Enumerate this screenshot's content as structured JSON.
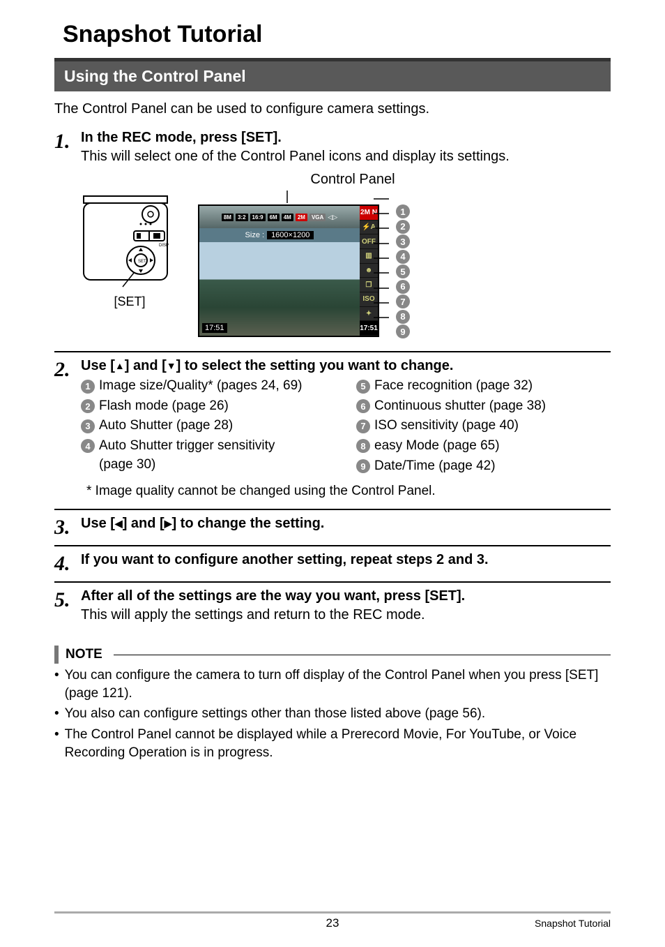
{
  "title": "Snapshot Tutorial",
  "section": "Using the Control Panel",
  "intro": "The Control Panel can be used to configure camera settings.",
  "steps": {
    "s1": {
      "num": "1.",
      "head": "In the REC mode, press [SET].",
      "sub": "This will select one of the Control Panel icons and display its settings.",
      "cp_label": "Control Panel",
      "set_label": "[SET]",
      "chips": [
        "8M",
        "3:2",
        "16:9",
        "6M",
        "4M",
        "2M",
        "VGA"
      ],
      "size_label": "Size :",
      "size_value": "1600×1200",
      "time": "17:51",
      "side_icons": [
        "2M N",
        "⚡A",
        "OFF",
        "▥",
        "☻",
        "❐",
        "ISO",
        "✦",
        "17:51"
      ]
    },
    "s2": {
      "num": "2.",
      "head_a": "Use [",
      "head_b": "] and [",
      "head_c": "] to select the setting you want to change.",
      "items_left": [
        "Image size/Quality* (pages 24, 69)",
        "Flash mode (page 26)",
        "Auto Shutter (page 28)",
        "Auto Shutter trigger sensitivity"
      ],
      "items_left_cont": "(page 30)",
      "items_right": [
        "Face recognition (page 32)",
        "Continuous shutter (page 38)",
        "ISO sensitivity (page 40)",
        "easy Mode (page 65)",
        "Date/Time (page 42)"
      ],
      "footnote": "* Image quality cannot be changed using the Control Panel."
    },
    "s3": {
      "num": "3.",
      "head_a": "Use [",
      "head_b": "] and [",
      "head_c": "] to change the setting."
    },
    "s4": {
      "num": "4.",
      "head": "If you want to configure another setting, repeat steps 2 and 3."
    },
    "s5": {
      "num": "5.",
      "head": "After all of the settings are the way you want, press [SET].",
      "sub": "This will apply the settings and return to the REC mode."
    }
  },
  "note": {
    "label": "NOTE",
    "items": [
      "You can configure the camera to turn off display of the Control Panel when you press [SET] (page 121).",
      "You also can configure settings other than those listed above (page 56).",
      "The Control Panel cannot be displayed while a Prerecord Movie, For YouTube, or Voice Recording Operation is in progress."
    ]
  },
  "footer": {
    "page": "23",
    "label": "Snapshot Tutorial"
  }
}
